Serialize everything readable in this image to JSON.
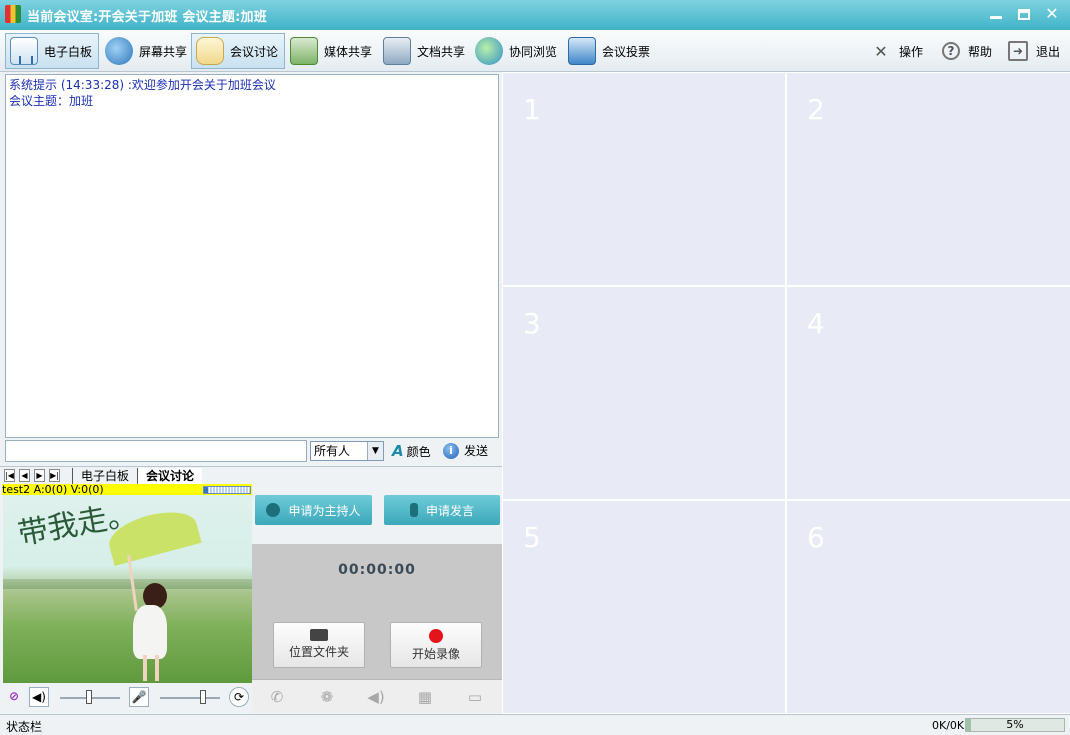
{
  "window": {
    "title": "当前会议室:开会关于加班 会议主题:加班"
  },
  "toolbar": {
    "items": [
      {
        "label": "电子白板",
        "icon": "whiteboard-icon"
      },
      {
        "label": "屏幕共享",
        "icon": "screen-share-icon"
      },
      {
        "label": "会议讨论",
        "icon": "discussion-icon"
      },
      {
        "label": "媒体共享",
        "icon": "media-share-icon"
      },
      {
        "label": "文档共享",
        "icon": "document-share-icon"
      },
      {
        "label": "协同浏览",
        "icon": "co-browse-icon"
      },
      {
        "label": "会议投票",
        "icon": "vote-icon"
      }
    ],
    "right": [
      {
        "label": "操作",
        "icon": "tools-icon"
      },
      {
        "label": "帮助",
        "icon": "help-icon"
      },
      {
        "label": "退出",
        "icon": "exit-icon"
      }
    ]
  },
  "chat": {
    "messages": [
      "系统提示 (14:33:28) :欢迎参加开会关于加班会议",
      "会议主题：加班"
    ],
    "input_value": "",
    "recipient": "所有人",
    "color_label": "颜色",
    "send_label": "发送"
  },
  "tabs": {
    "items": [
      "电子白板",
      "会议讨论"
    ],
    "active": "会议讨论"
  },
  "user_panel": {
    "status_line": "test2 A:0(0) V:0(0)",
    "video_caption": "带我走。",
    "audio_level": 0.08
  },
  "recording": {
    "apply_host_label": "申请为主持人",
    "apply_speak_label": "申请发言",
    "timer": "00:00:00",
    "folder_label": "位置文件夹",
    "record_label": "开始录像"
  },
  "grid": {
    "cells": [
      "1",
      "2",
      "3",
      "4",
      "5",
      "6"
    ]
  },
  "status": {
    "text": "状态栏",
    "speed": "0K/0K",
    "progress_label": "5%",
    "progress": 0.05
  },
  "colors": {
    "titlebar": "#3fb4c8",
    "accent": "#3ca8b9",
    "grid_cell": "#e8ebf5",
    "user_bar": "#ffff00",
    "record": "#e3141a"
  }
}
